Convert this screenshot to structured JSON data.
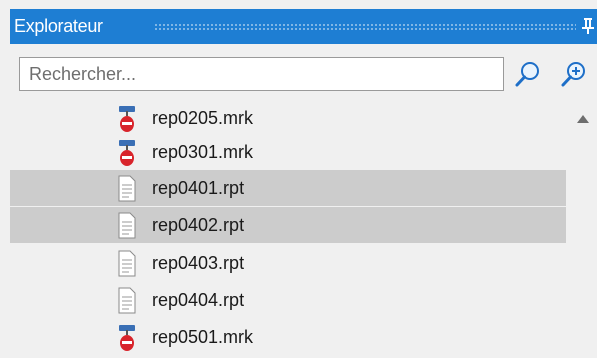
{
  "panel": {
    "title": "Explorateur",
    "pin_icon": "pin-icon",
    "accent_color": "#1e7ed3",
    "selected_color": "#cccccc"
  },
  "search": {
    "placeholder": "Rechercher...",
    "value": "",
    "search_icon": "search-icon",
    "zoom_icon": "zoom-in-icon"
  },
  "tree": {
    "items": [
      {
        "label": "rep0205.mrk",
        "icon": "marker-icon",
        "selected": false
      },
      {
        "label": "rep0301.mrk",
        "icon": "marker-icon",
        "selected": false
      },
      {
        "label": "rep0401.rpt",
        "icon": "document-icon",
        "selected": true
      },
      {
        "label": "rep0402.rpt",
        "icon": "document-icon",
        "selected": true
      },
      {
        "label": "rep0403.rpt",
        "icon": "document-icon",
        "selected": false
      },
      {
        "label": "rep0404.rpt",
        "icon": "document-icon",
        "selected": false
      },
      {
        "label": "rep0501.mrk",
        "icon": "marker-icon",
        "selected": false
      }
    ]
  }
}
